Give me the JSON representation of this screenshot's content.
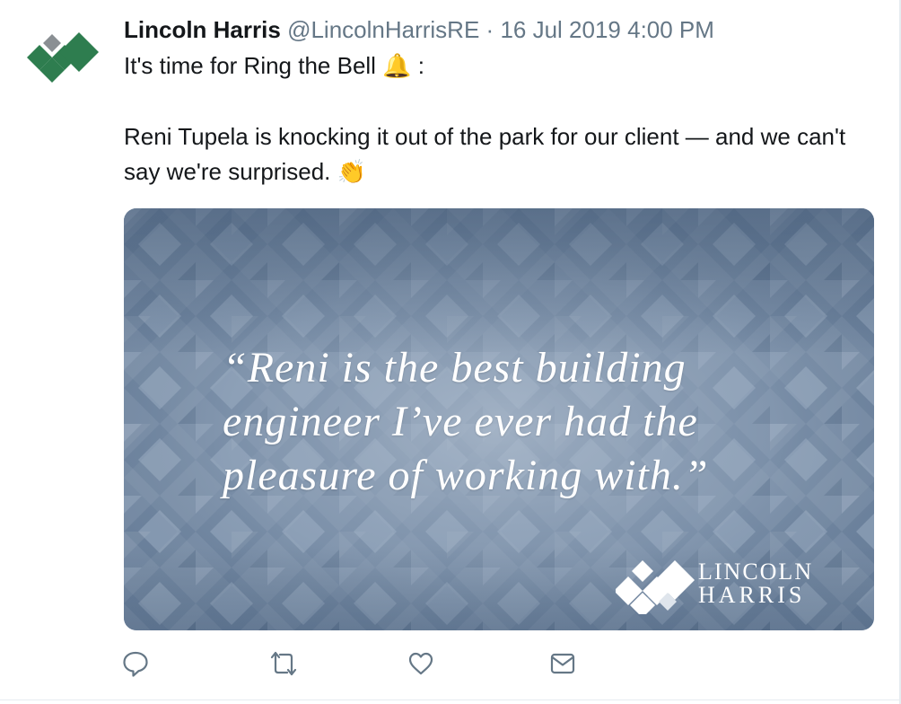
{
  "tweet": {
    "author_name": "Lincoln Harris",
    "handle": "@LincolnHarrisRE",
    "separator": "·",
    "timestamp": "16 Jul 2019 4:00 PM",
    "text_line1": "It's time for Ring the Bell",
    "bell_emoji": "🔔",
    "text_line1_suffix": " :",
    "text_para2": "Reni Tupela is knocking it out of the park for our client — and we can't say we're surprised.",
    "clap_emoji": "👏"
  },
  "media": {
    "quote_lines": [
      "“Reni is the best building",
      "engineer I’ve ever had the",
      "pleasure of working with.”"
    ],
    "brand_line1": "LINCOLN",
    "brand_line2": "HARRIS"
  },
  "actions": {
    "reply_icon": "reply-icon",
    "retweet_icon": "retweet-icon",
    "like_icon": "heart-icon",
    "dm_icon": "envelope-icon"
  },
  "colors": {
    "text": "#14171a",
    "muted": "#657786",
    "logo_green": "#2e7d4f",
    "logo_gray": "#8a8f93",
    "media_blue": "#7c90a8",
    "icon": "#657786"
  }
}
